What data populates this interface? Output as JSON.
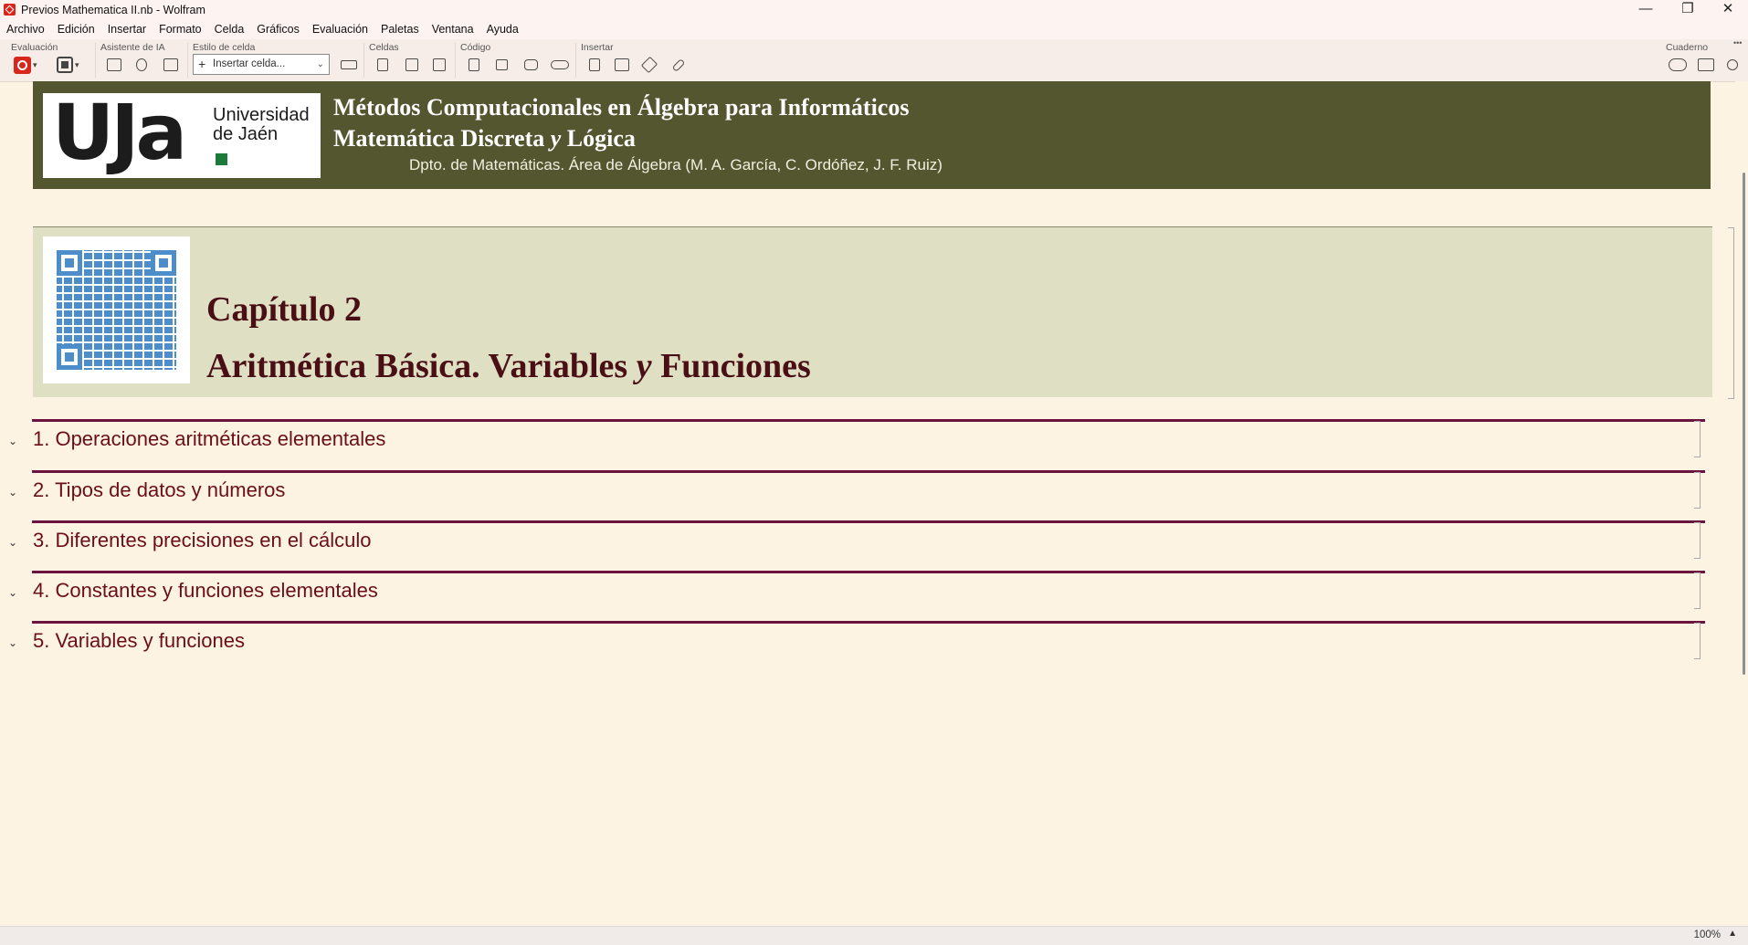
{
  "window": {
    "title": "Previos Mathematica II.nb - Wolfram",
    "minimize": "—",
    "restore": "❐",
    "close": "✕"
  },
  "menu": [
    "Archivo",
    "Edición",
    "Insertar",
    "Formato",
    "Celda",
    "Gráficos",
    "Evaluación",
    "Paletas",
    "Ventana",
    "Ayuda"
  ],
  "toolbar": {
    "groups": {
      "evaluacion": "Evaluación",
      "asistente": "Asistente de IA",
      "estilo": "Estilo de celda",
      "celdas": "Celdas",
      "codigo": "Código",
      "insertar": "Insertar",
      "cuaderno": "Cuaderno"
    },
    "cell_style_select": "Insertar celda...",
    "more": "•••"
  },
  "banner": {
    "logo_text": "UJa",
    "logo_univ_line1": "Universidad",
    "logo_univ_line2": "de Jaén",
    "title_line1": "Métodos Computacionales en Álgebra para Informáticos",
    "title_line2_a": "Matemática Discreta ",
    "title_line2_y": "y",
    "title_line2_b": " Lógica",
    "subtitle": "Dpto. de Matemáticas. Área de  Álgebra (M. A. García,  C. Ordóñez,  J. F. Ruiz)"
  },
  "chapter": {
    "number": "Capítulo 2",
    "title_a": "Aritmética Básica. Variables ",
    "title_y": "y",
    "title_b": " Funciones"
  },
  "sections": [
    "1. Operaciones aritméticas elementales",
    "2. Tipos de datos y números",
    "3. Diferentes precisiones en el cálculo",
    "4. Constantes y funciones elementales",
    "5. Variables y funciones"
  ],
  "status": {
    "zoom": "100%"
  },
  "colors": {
    "banner_bg": "#545630",
    "chapter_bg": "#dfdfc3",
    "notebook_bg": "#fdf3e3",
    "section_rule": "#6b1440",
    "section_text": "#6b0f16"
  }
}
